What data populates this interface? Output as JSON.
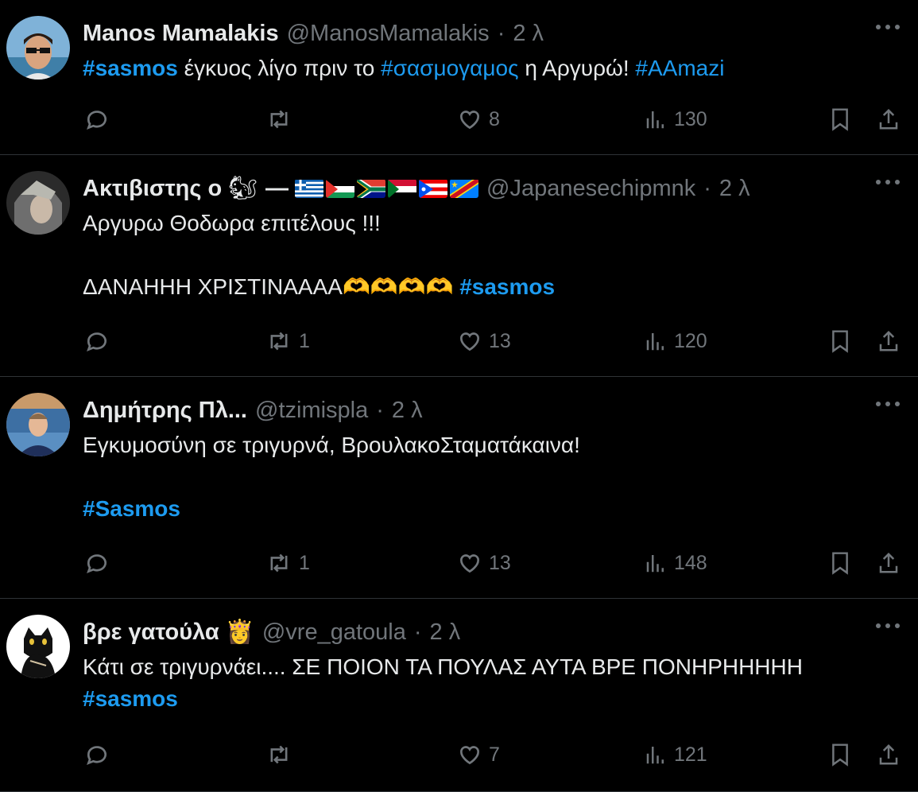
{
  "tweets": [
    {
      "name": "Manos Mamalakis",
      "handle": "@ManosMamalakis",
      "dot": "·",
      "time": "2 λ",
      "lines": [
        [
          {
            "t": "#sasmos",
            "tag": true,
            "bold": true
          },
          {
            "t": " έγκυος λίγο πριν το "
          },
          {
            "t": "#σασμογαμος",
            "tag": true
          },
          {
            "t": " η Αργυρώ! "
          },
          {
            "t": "#AAmazi",
            "tag": true
          }
        ]
      ],
      "replies": "",
      "reposts": "",
      "likes": "8",
      "views": "130",
      "avatar_color": "#4a7fb0"
    },
    {
      "name": "Ακτιβιστης ο",
      "name_emoji": "🐿",
      "name_dash": "—",
      "flags": [
        "greece",
        "palestine",
        "south-africa",
        "sudan",
        "puerto-rico",
        "dr-congo"
      ],
      "handle": "@Japanesechipmnk",
      "dot": "·",
      "time": "2 λ",
      "lines": [
        [
          {
            "t": "Αργυρω Θοδωρα επιτέλους !!!"
          }
        ],
        [],
        [
          {
            "t": "ΔΑΝΑΗΗΗ ΧΡΙΣΤΙΝΑΑΑΑ"
          },
          {
            "t": "🫶🫶🫶🫶",
            "emoji": true
          },
          {
            "t": " "
          },
          {
            "t": "#sasmos",
            "tag": true,
            "bold": true
          }
        ]
      ],
      "replies": "",
      "reposts": "1",
      "likes": "13",
      "views": "120",
      "avatar_color": "#5a5a5a"
    },
    {
      "name": "Δημήτρης Πλ...",
      "handle": "@tzimispla",
      "dot": "·",
      "time": "2 λ",
      "lines": [
        [
          {
            "t": "Εγκυμοσύνη σε τριγυρνά, ΒρουλακοΣταματάκαινα!"
          }
        ],
        [],
        [
          {
            "t": "#Sasmos",
            "tag": true,
            "bold": true
          }
        ]
      ],
      "replies": "",
      "reposts": "1",
      "likes": "13",
      "views": "148",
      "avatar_color": "#6a8fb8"
    },
    {
      "name": "βρε γατούλα",
      "name_emoji": "👸",
      "handle": "@vre_gatoula",
      "dot": "·",
      "time": "2 λ",
      "lines": [
        [
          {
            "t": "Κάτι σε τριγυρνάει.... ΣΕ ΠΟΙΟΝ ΤΑ ΠΟΥΛΑΣ ΑΥΤΑ ΒΡΕ ΠΟΝΗΡΗΗΗΗΗ"
          }
        ],
        [
          {
            "t": "#sasmos",
            "tag": true,
            "bold": true
          }
        ]
      ],
      "replies": "",
      "reposts": "",
      "likes": "7",
      "views": "121",
      "avatar_color": "#ffffff"
    }
  ]
}
